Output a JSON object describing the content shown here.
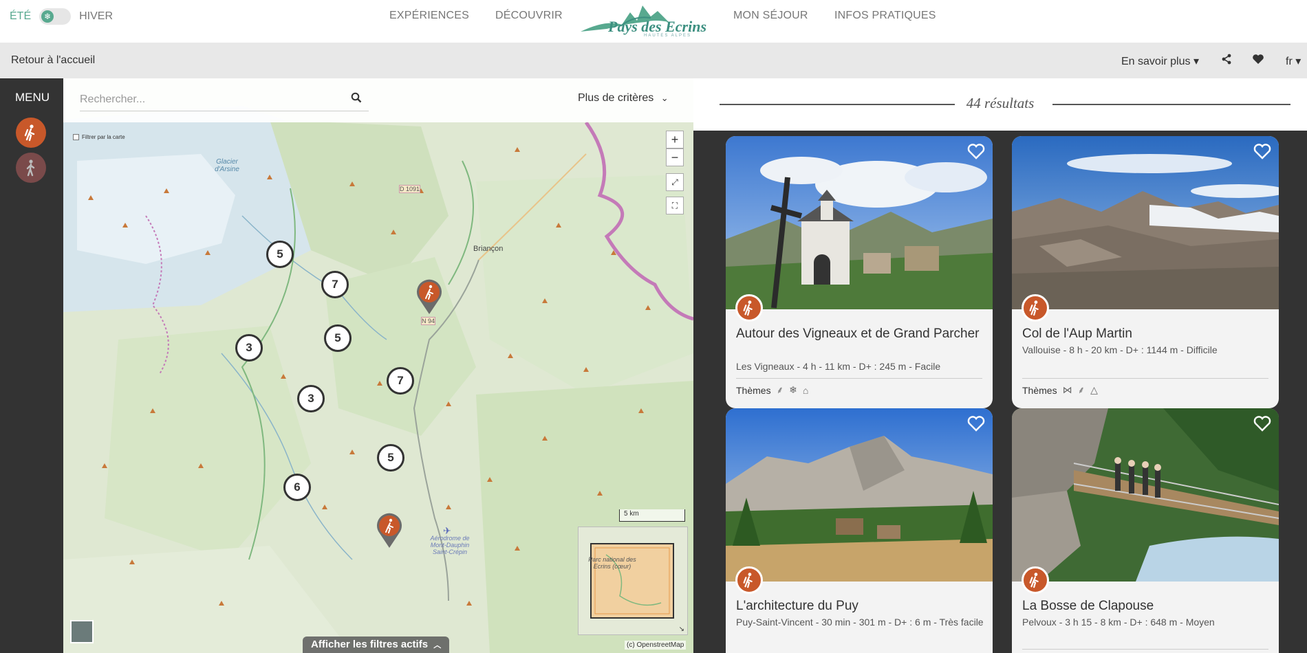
{
  "season": {
    "summer_label": "ÉTÉ",
    "winter_label": "HIVER"
  },
  "nav": {
    "item1": "EXPÉRIENCES",
    "item2": "DÉCOUVRIR",
    "item3": "MON SÉJOUR",
    "item4": "INFOS PRATIQUES"
  },
  "logo": {
    "name": "Pays des Ecrins",
    "tagline": "HAUTES ALPES"
  },
  "subbar": {
    "back_label": "Retour à l'accueil",
    "more_label": "En savoir plus ▾",
    "language": "fr ▾",
    "share_icon": "share-icon",
    "favorites_icon": "heart-icon"
  },
  "menu": {
    "label": "MENU",
    "practices": [
      {
        "icon": "hiker-icon",
        "active": true
      },
      {
        "icon": "walker-icon",
        "active": false
      }
    ]
  },
  "map": {
    "search_placeholder": "Rechercher...",
    "criteria_label": "Plus de critères",
    "filter_checkbox_label": "Filtrer par la carte",
    "zoom_in": "+",
    "zoom_out": "−",
    "scale_label": "5 km",
    "attribution": "(c) OpenstreetMap",
    "active_filters_label": "Afficher les filtres actifs",
    "place_labels": {
      "briancon": "Briançon",
      "glacier": "Glacier d'Arsine",
      "road1": "D 1091",
      "road2": "N 94",
      "aerodrome": "Aérodrome de Mont-Dauphin Saint-Crépin",
      "parc": "Parc national des Ecrins (cœur)"
    },
    "clusters": [
      "5",
      "7",
      "5",
      "3",
      "3",
      "7",
      "5",
      "6"
    ]
  },
  "results": {
    "count_label": "44 résultats",
    "themes_label": "Thèmes",
    "cards": [
      {
        "title": "Autour des Vigneaux et de Grand Parcher",
        "meta": "Les Vigneaux  -  4 h  -  11 km  -  D+ : 245 m  -  Facile"
      },
      {
        "title": "Col de l'Aup Martin",
        "meta": "Vallouise  -  8 h  -  20 km  -  D+ : 1144 m  -  Difficile"
      },
      {
        "title": "L'architecture du Puy",
        "meta": "Puy-Saint-Vincent  -  30 min  -  301 m  -  D+ : 6 m  -  Très facile"
      },
      {
        "title": "La Bosse de Clapouse",
        "meta": "Pelvoux  -  3 h 15  -  8 km  -  D+ : 648 m  -  Moyen"
      }
    ]
  },
  "colors": {
    "accent_green": "#58a98f",
    "practice_orange": "#c8582a",
    "map_route_purple": "#c47ab8"
  }
}
